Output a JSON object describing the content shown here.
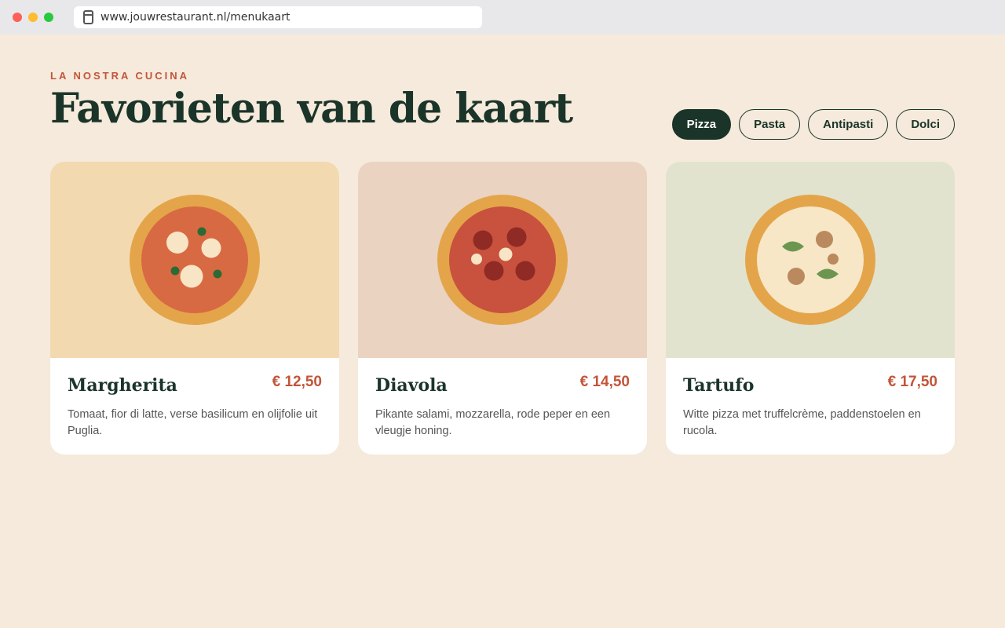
{
  "browser": {
    "url": "www.jouwrestaurant.nl/menukaart"
  },
  "header": {
    "eyebrow": "LA NOSTRA CUCINA",
    "title": "Favorieten van de kaart"
  },
  "tabs": [
    {
      "label": "Pizza",
      "active": true
    },
    {
      "label": "Pasta",
      "active": false
    },
    {
      "label": "Antipasti",
      "active": false
    },
    {
      "label": "Dolci",
      "active": false
    }
  ],
  "cards": [
    {
      "name": "Margherita",
      "price": "€ 12,50",
      "description": "Tomaat, fior di latte, verse basilicum en olijfolie uit Puglia.",
      "bg_color": "#f2d9b0",
      "icon": "pizza-margherita-icon"
    },
    {
      "name": "Diavola",
      "price": "€ 14,50",
      "description": "Pikante salami, mozzarella, rode peper en een vleugje honing.",
      "bg_color": "#ead3c1",
      "icon": "pizza-diavola-icon"
    },
    {
      "name": "Tartufo",
      "price": "€ 17,50",
      "description": "Witte pizza met truffelcrème, paddenstoelen en rucola.",
      "bg_color": "#e1e3cf",
      "icon": "pizza-tartufo-icon"
    }
  ],
  "colors": {
    "accent": "#c2553a",
    "dark": "#1b3429",
    "background": "#f5eadb"
  }
}
